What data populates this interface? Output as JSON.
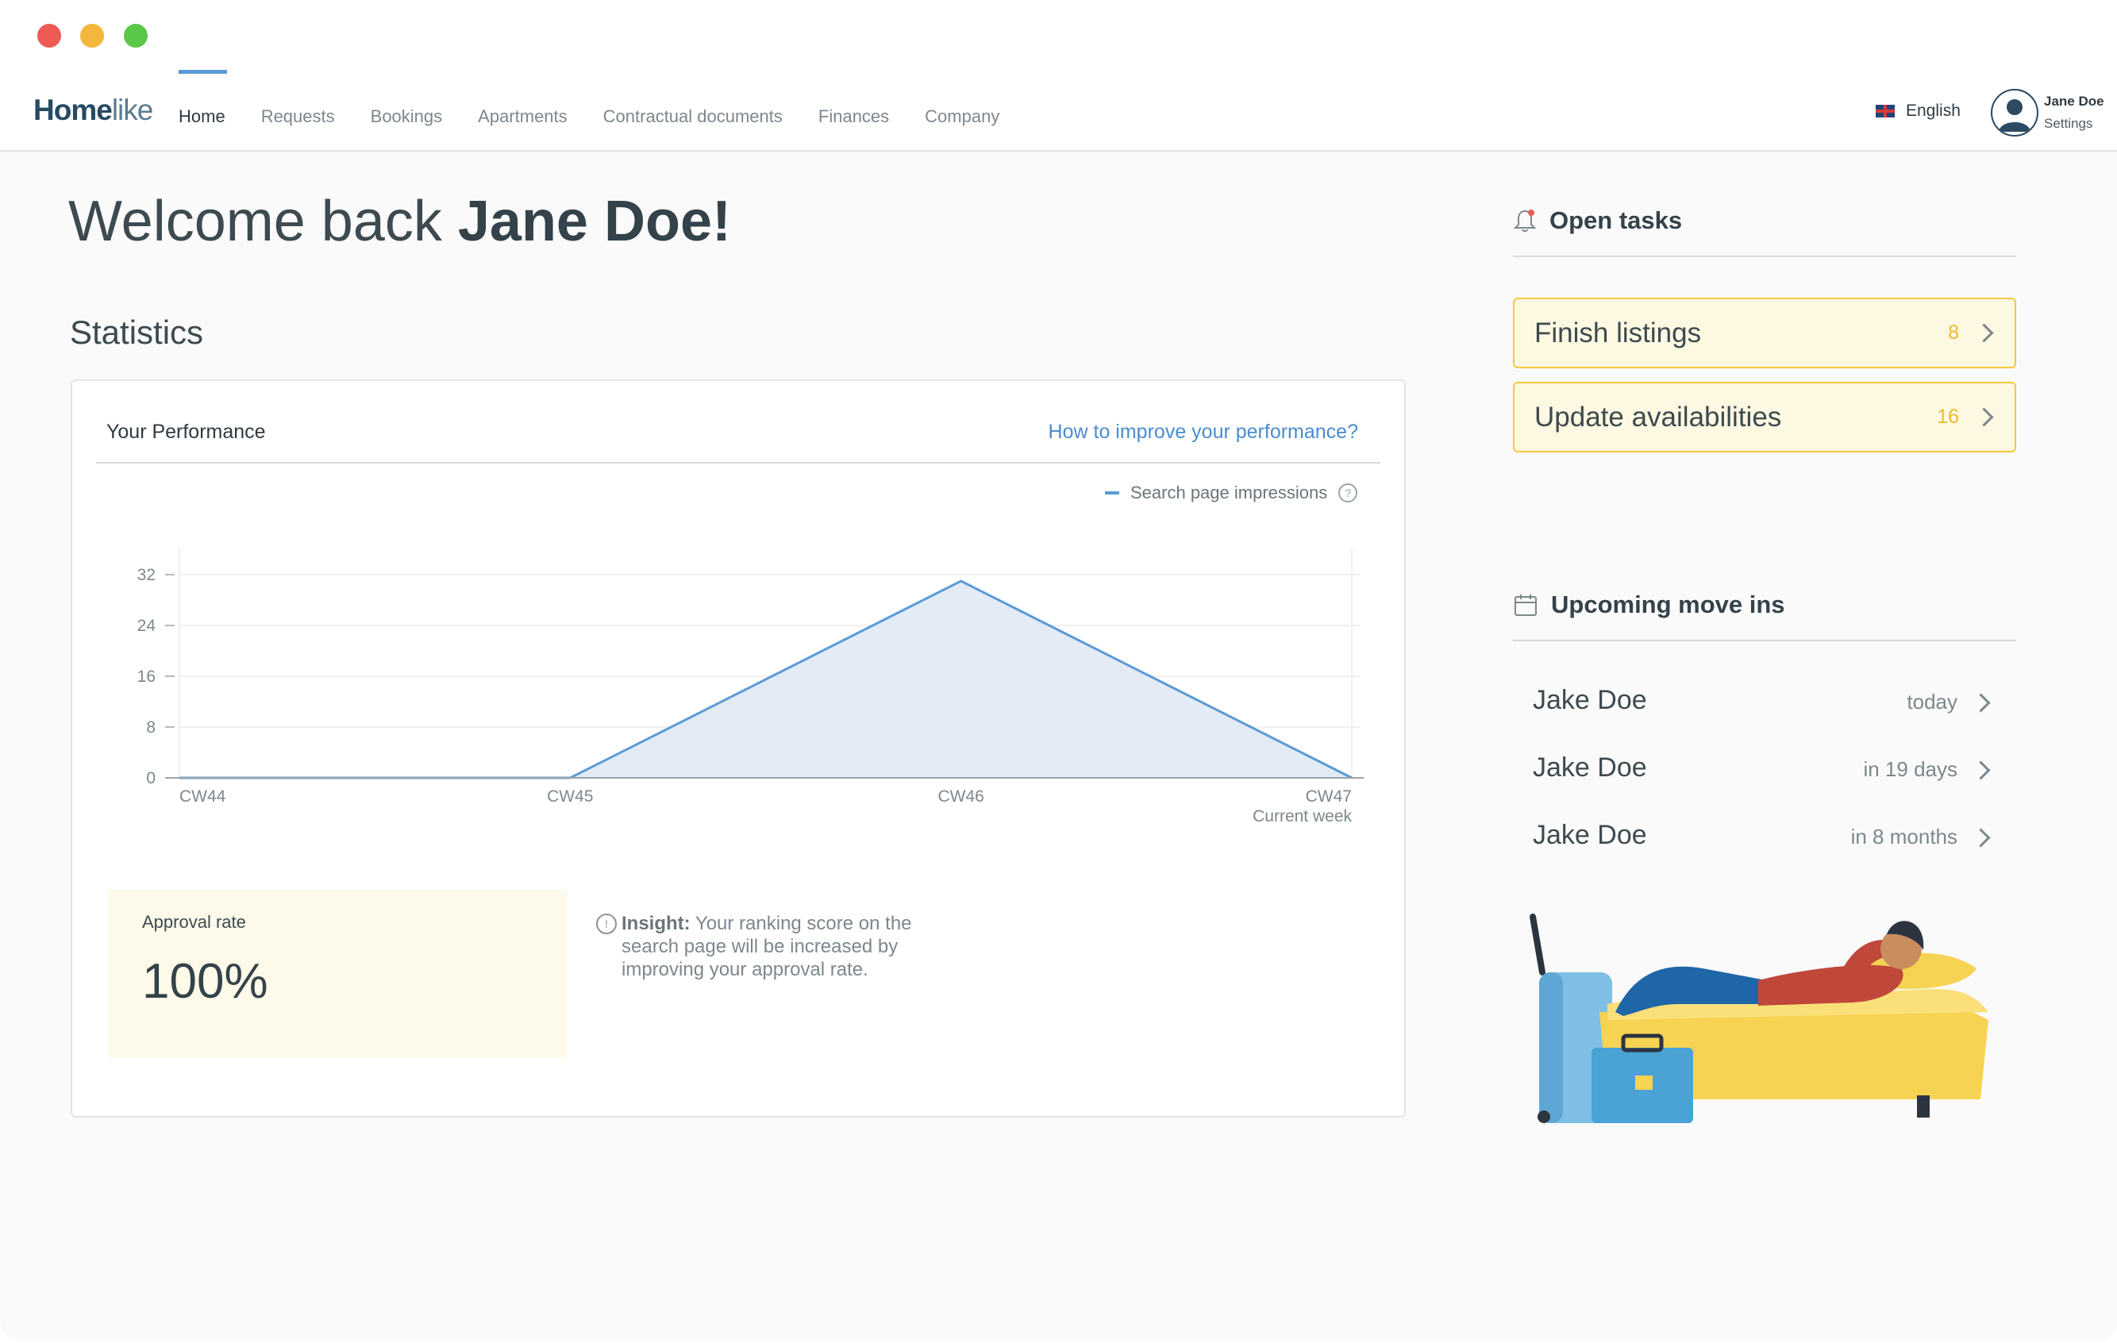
{
  "window": {
    "controls": [
      "close",
      "minimize",
      "maximize"
    ]
  },
  "header": {
    "logo_bold": "Home",
    "logo_light": "like",
    "nav": [
      {
        "label": "Home",
        "active": true
      },
      {
        "label": "Requests"
      },
      {
        "label": "Bookings"
      },
      {
        "label": "Apartments"
      },
      {
        "label": "Contractual documents"
      },
      {
        "label": "Finances"
      },
      {
        "label": "Company"
      }
    ],
    "language": "English",
    "user_name": "Jane Doe",
    "user_settings": "Settings"
  },
  "main": {
    "welcome_prefix": "Welcome back ",
    "welcome_name": "Jane Doe!",
    "statistics_title": "Statistics",
    "performance": {
      "title": "Your Performance",
      "link": "How to improve your performance?",
      "legend": "Search page impressions",
      "help": "?",
      "approval_label": "Approval rate",
      "approval_value": "100%",
      "insight_label": "Insight:",
      "insight_text": " Your ranking score on the search page will be increased by improving your approval rate.",
      "current_week_label": "Current week"
    }
  },
  "chart_data": {
    "type": "area",
    "categories": [
      "CW44",
      "CW45",
      "CW46",
      "CW47"
    ],
    "series": [
      {
        "name": "Search page impressions",
        "values": [
          0,
          0,
          31,
          0
        ]
      }
    ],
    "yticks": [
      0,
      8,
      16,
      24,
      32
    ],
    "ylim": [
      0,
      35
    ],
    "grid": true,
    "legend_position": "top-right",
    "colors": {
      "line": "#5b9bd5",
      "fill": "#e3ebf6",
      "grid": "#ececec",
      "axis": "#9aa3a8"
    }
  },
  "sidebar": {
    "open_tasks_title": "Open tasks",
    "tasks": [
      {
        "label": "Finish listings",
        "count": "8"
      },
      {
        "label": "Update availabilities",
        "count": "16"
      }
    ],
    "upcoming_title": "Upcoming move ins",
    "move_ins": [
      {
        "name": "Jake Doe",
        "when": "today"
      },
      {
        "name": "Jake Doe",
        "when": "in 19 days"
      },
      {
        "name": "Jake Doe",
        "when": "in 8 months"
      }
    ]
  },
  "colors": {
    "accent": "#5b9bd5",
    "task_border": "#f3c93e",
    "task_bg": "#fdf8e2",
    "link": "#4a8ccf"
  }
}
